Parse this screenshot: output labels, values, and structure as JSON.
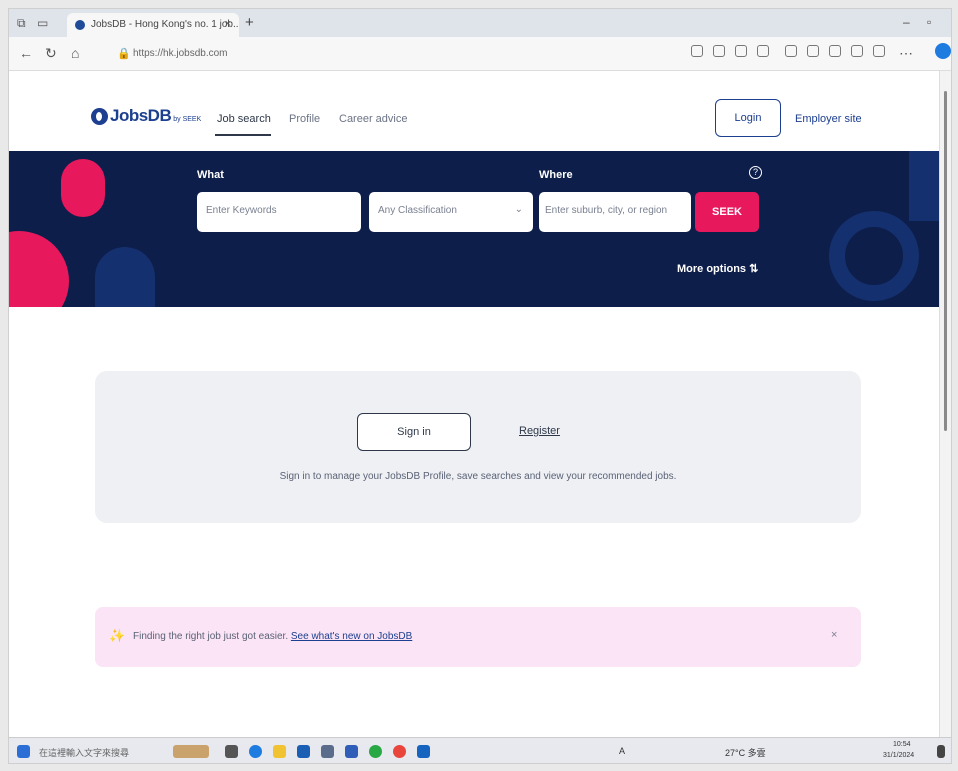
{
  "browser": {
    "tab_title": "JobsDB - Hong Kong's no. 1 job...",
    "tab_close": "×",
    "new_tab": "+",
    "url": "https://hk.jobsdb.com"
  },
  "header": {
    "logo_text": "JobsDB",
    "logo_by": "by SEEK",
    "nav": [
      "Job search",
      "Profile",
      "Career advice"
    ],
    "login_label": "Login",
    "employer_label": "Employer site"
  },
  "search": {
    "what_label": "What",
    "where_label": "Where",
    "keywords_placeholder": "Enter Keywords",
    "classification_value": "Any Classification",
    "location_placeholder": "Enter suburb, city, or region",
    "seek_label": "SEEK",
    "help_glyph": "?",
    "more_options_label": "More options"
  },
  "signin_card": {
    "signin_label": "Sign in",
    "register_label": "Register",
    "description": "Sign in to manage your JobsDB Profile, save searches and view your recommended jobs."
  },
  "banner": {
    "text": "Finding the right job just got easier.",
    "link": "See what's new on JobsDB",
    "close": "×"
  },
  "taskbar": {
    "search_placeholder": "在這裡輸入文字來搜尋",
    "weather": "27°C 多雲",
    "lang": "A",
    "time": "10:54",
    "date": "31/1/2024"
  },
  "colors": {
    "brand_navy": "#0d1e4b",
    "brand_blue": "#1c3f8f",
    "brand_pink": "#e8185d"
  }
}
